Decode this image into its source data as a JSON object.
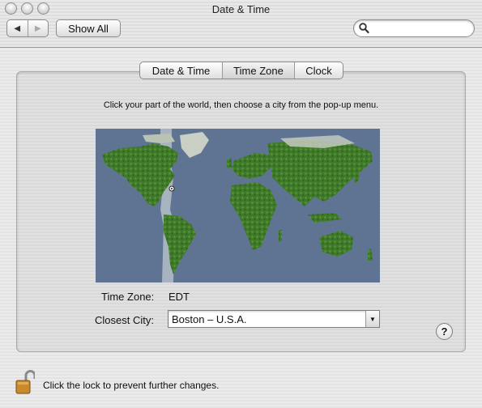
{
  "window": {
    "title": "Date & Time"
  },
  "toolbar": {
    "back_glyph": "◀",
    "forward_glyph": "▶",
    "show_all_label": "Show All",
    "search_placeholder": "",
    "search_value": ""
  },
  "tabs": [
    {
      "label": "Date & Time",
      "active": false
    },
    {
      "label": "Time Zone",
      "active": true
    },
    {
      "label": "Clock",
      "active": false
    }
  ],
  "time_zone_pane": {
    "instructions": "Click your part of the world, then choose a city from the pop-up menu.",
    "time_zone_label": "Time Zone:",
    "time_zone_value": "EDT",
    "closest_city_label": "Closest City:",
    "closest_city_value": "Boston – U.S.A."
  },
  "help": {
    "glyph": "?"
  },
  "footer": {
    "lock_text": "Click the lock to prevent further changes."
  },
  "icons": [
    "close-button",
    "minimize-button",
    "zoom-button",
    "back-arrow-icon",
    "forward-arrow-icon",
    "search-icon",
    "help-icon",
    "lock-icon",
    "popup-arrow-icon"
  ],
  "colors": {
    "ocean": "#5f7392",
    "land": "#3f7a2a",
    "ice": "#c9cfc4",
    "time_zone_band": "#d9dde0"
  }
}
